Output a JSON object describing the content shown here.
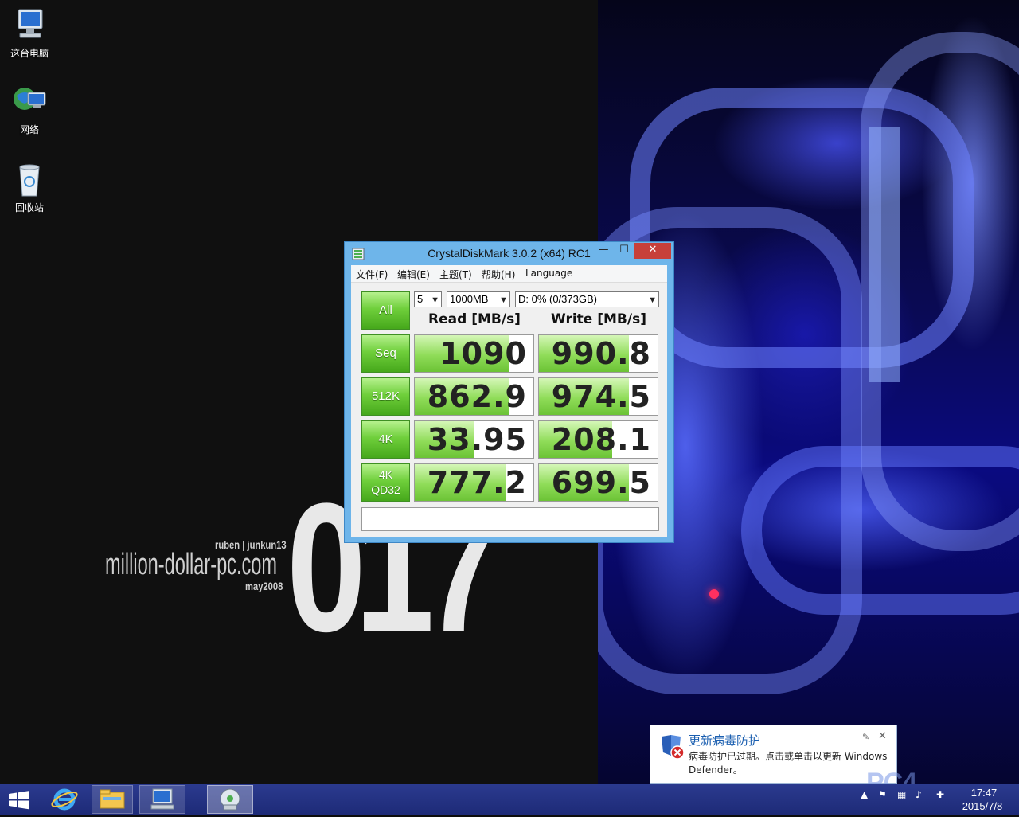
{
  "desktop": {
    "icons": [
      {
        "label": "这台电脑",
        "icon": "computer-icon"
      },
      {
        "label": "网络",
        "icon": "network-icon"
      },
      {
        "label": "回收站",
        "icon": "recycle-bin-icon"
      }
    ],
    "wallpaper": {
      "big_text": "017",
      "site_text": "million-dollar-pc.com",
      "author_text": "ruben | junkun13",
      "date_text": "may2008"
    }
  },
  "cdm": {
    "title": "CrystalDiskMark 3.0.2 (x64) RC1",
    "menu": [
      "文件(F)",
      "编辑(E)",
      "主题(T)",
      "帮助(H)",
      "Language"
    ],
    "controls": {
      "count": "5",
      "size": "1000MB",
      "drive": "D: 0% (0/373GB)"
    },
    "all_label": "All",
    "read_header": "Read [MB/s]",
    "write_header": "Write [MB/s]",
    "rows": [
      {
        "label": "Seq",
        "label2": "",
        "read": "1090",
        "write": "990.8",
        "read_fill": 0.8,
        "write_fill": 0.76
      },
      {
        "label": "512K",
        "label2": "",
        "read": "862.9",
        "write": "974.5",
        "read_fill": 0.8,
        "write_fill": 0.76
      },
      {
        "label": "4K",
        "label2": "",
        "read": "33.95",
        "write": "208.1",
        "read_fill": 0.5,
        "write_fill": 0.62
      },
      {
        "label": "4K",
        "label2": "QD32",
        "read": "777.2",
        "write": "699.5",
        "read_fill": 0.77,
        "write_fill": 0.76
      }
    ],
    "comment": "",
    "colors": {
      "accent": "#6eb5ea",
      "green": "#6fcf3b",
      "close": "#c7403a"
    }
  },
  "toast": {
    "title": "更新病毒防护",
    "body": "病毒防护已过期。点击或单击以更新 Windows Defender。",
    "icon": "shield-error-icon"
  },
  "taskbar": {
    "items": [
      "start-icon",
      "internet-explorer-icon",
      "file-explorer-icon",
      "this-pc-icon",
      "crystaldiskmark-icon"
    ],
    "time": "17:47",
    "date": "2015/7/8",
    "watermark": "PC4"
  }
}
